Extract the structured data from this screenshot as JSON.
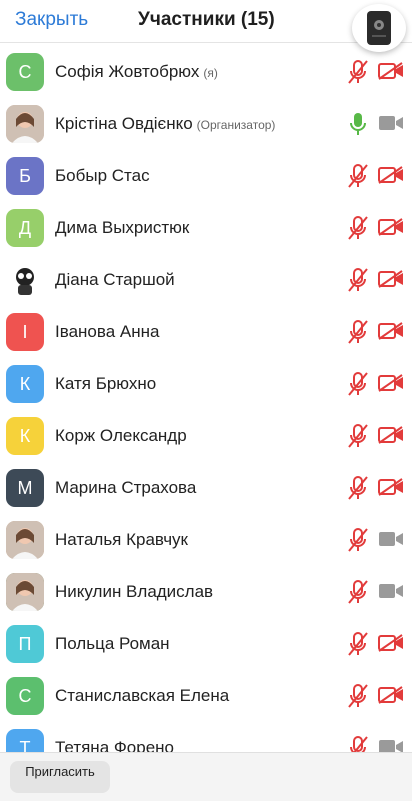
{
  "header": {
    "close_label": "Закрыть",
    "title": "Участники (15)"
  },
  "colors": {
    "accent": "#2d7bd7",
    "muted_red": "#e23b3b",
    "mic_on_green": "#58b947",
    "cam_on_gray": "#9a9a9a"
  },
  "participants": [
    {
      "initial": "С",
      "name": "Софія Жовтобрюх",
      "tag": "(я)",
      "color": "#6cc06a",
      "mic": "off",
      "cam": "off"
    },
    {
      "initial": "",
      "name": "Крістіна Овдієнко",
      "tag": "(Организатор)",
      "color": "#d9c4b8",
      "mic": "on",
      "cam": "on",
      "photo": true
    },
    {
      "initial": "Б",
      "name": "Бобыр Стас",
      "tag": "",
      "color": "#6b74c6",
      "mic": "off",
      "cam": "off"
    },
    {
      "initial": "Д",
      "name": "Дима Выхристюк",
      "tag": "",
      "color": "#97cf6a",
      "mic": "off",
      "cam": "off"
    },
    {
      "initial": "",
      "name": "Діана Старшой",
      "tag": "",
      "color": "#ffffff",
      "mic": "off",
      "cam": "off",
      "photo": true
    },
    {
      "initial": "І",
      "name": "Іванова Анна",
      "tag": "",
      "color": "#ef5350",
      "mic": "off",
      "cam": "off"
    },
    {
      "initial": "К",
      "name": "Катя Брюхно",
      "tag": "",
      "color": "#4fa7ef",
      "mic": "off",
      "cam": "off"
    },
    {
      "initial": "К",
      "name": "Корж Олександр",
      "tag": "",
      "color": "#f6d23a",
      "mic": "off",
      "cam": "off"
    },
    {
      "initial": "М",
      "name": "Марина Страхова",
      "tag": "",
      "color": "#3d4a57",
      "mic": "off",
      "cam": "off"
    },
    {
      "initial": "",
      "name": "Наталья Кравчук",
      "tag": "",
      "color": "#c9a07a",
      "mic": "off",
      "cam": "on",
      "photo": true
    },
    {
      "initial": "",
      "name": "Никулин Владислав",
      "tag": "",
      "color": "#5b7a4a",
      "mic": "off",
      "cam": "on",
      "photo": true
    },
    {
      "initial": "П",
      "name": "Польца Роман",
      "tag": "",
      "color": "#4fc9d6",
      "mic": "off",
      "cam": "off"
    },
    {
      "initial": "С",
      "name": "Станиславская Елена",
      "tag": "",
      "color": "#5cbf6e",
      "mic": "off",
      "cam": "off"
    },
    {
      "initial": "Т",
      "name": "Тетяна Форено",
      "tag": "",
      "color": "#4fa7ef",
      "mic": "off",
      "cam": "on"
    }
  ],
  "footer": {
    "invite_label": "Пригласить"
  }
}
